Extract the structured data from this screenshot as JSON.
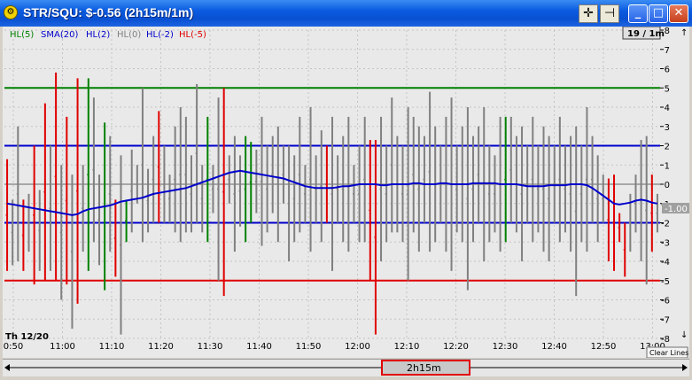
{
  "window": {
    "title": "STR/SQU: $-0.56 (2h15m/1m)",
    "icon": "gear-icon",
    "tool_buttons": [
      {
        "name": "crosshair-icon",
        "glyph": "✛"
      },
      {
        "name": "pin-icon",
        "glyph": "⊣"
      }
    ],
    "win_buttons": {
      "minimize": "_",
      "maximize": "□",
      "close": "✕"
    }
  },
  "legend": [
    {
      "label": "HL(5)",
      "color": "#008000"
    },
    {
      "label": "SMA(20)",
      "color": "#0000cc"
    },
    {
      "label": "HL(2)",
      "color": "#0000cc"
    },
    {
      "label": "HL(0)",
      "color": "#808080"
    },
    {
      "label": "HL(-2)",
      "color": "#0000cc"
    },
    {
      "label": "HL(-5)",
      "color": "#e00000"
    }
  ],
  "zoom_label": "19 / 1m",
  "current_value_label": "-1.00",
  "day_label": "Th 12/20",
  "clear_lines_label": "Clear Lines",
  "scroll_label": "2h15m",
  "colors": {
    "up": "#008000",
    "down": "#e00000",
    "neutral": "#808080",
    "sma": "#0000cc"
  },
  "chart_data": {
    "type": "bar",
    "x_tick_labels": [
      "0:50",
      "11:00",
      "11:10",
      "11:20",
      "11:30",
      "11:40",
      "11:50",
      "12:00",
      "12:10",
      "12:20",
      "12:30",
      "12:40",
      "12:50",
      "13:00"
    ],
    "y_ticks": [
      -8,
      -7,
      -6,
      -5,
      -4,
      -3,
      -2,
      -1,
      0,
      1,
      2,
      3,
      4,
      5,
      6,
      7,
      8
    ],
    "ylim": [
      -8,
      8
    ],
    "horizontal_lines": [
      {
        "name": "HL(5)",
        "value": 5,
        "color": "#008000"
      },
      {
        "name": "HL(2)",
        "value": 2,
        "color": "#0000cc"
      },
      {
        "name": "HL(0)",
        "value": 0,
        "color": "#808080"
      },
      {
        "name": "HL(-2)",
        "value": -2,
        "color": "#0000cc"
      },
      {
        "name": "HL(-5)",
        "value": -5,
        "color": "#e00000"
      }
    ],
    "ranges": [
      {
        "t": 0,
        "low": -4.5,
        "high": 1.3,
        "c": "down"
      },
      {
        "t": 1,
        "low": -4.2,
        "high": -0.8,
        "c": "neutral"
      },
      {
        "t": 2,
        "low": -4.0,
        "high": 3.0,
        "c": "neutral"
      },
      {
        "t": 3,
        "low": -4.5,
        "high": -0.8,
        "c": "down"
      },
      {
        "t": 4,
        "low": -3.5,
        "high": -0.5,
        "c": "neutral"
      },
      {
        "t": 5,
        "low": -5.2,
        "high": 2.0,
        "c": "down"
      },
      {
        "t": 6,
        "low": -4.5,
        "high": -0.3,
        "c": "neutral"
      },
      {
        "t": 7,
        "low": -5.0,
        "high": 4.2,
        "c": "down"
      },
      {
        "t": 8,
        "low": -4.5,
        "high": 2.0,
        "c": "neutral"
      },
      {
        "t": 9,
        "low": -5.0,
        "high": 5.8,
        "c": "down"
      },
      {
        "t": 10,
        "low": -6.0,
        "high": 1.0,
        "c": "neutral"
      },
      {
        "t": 11,
        "low": -5.2,
        "high": 3.5,
        "c": "down"
      },
      {
        "t": 12,
        "low": -7.5,
        "high": 0.5,
        "c": "neutral"
      },
      {
        "t": 13,
        "low": -6.2,
        "high": 5.5,
        "c": "down"
      },
      {
        "t": 14,
        "low": -3.5,
        "high": 1.0,
        "c": "neutral"
      },
      {
        "t": 15,
        "low": -4.5,
        "high": 5.5,
        "c": "up"
      },
      {
        "t": 16,
        "low": -3.0,
        "high": 4.5,
        "c": "neutral"
      },
      {
        "t": 17,
        "low": -4.2,
        "high": 0.5,
        "c": "neutral"
      },
      {
        "t": 18,
        "low": -5.5,
        "high": 3.2,
        "c": "up"
      },
      {
        "t": 19,
        "low": -3.5,
        "high": 2.5,
        "c": "neutral"
      },
      {
        "t": 20,
        "low": -4.8,
        "high": -0.8,
        "c": "down"
      },
      {
        "t": 21,
        "low": -7.8,
        "high": 1.5,
        "c": "neutral"
      },
      {
        "t": 22,
        "low": -3.0,
        "high": -0.8,
        "c": "up"
      },
      {
        "t": 23,
        "low": -2.5,
        "high": 1.8,
        "c": "neutral"
      },
      {
        "t": 24,
        "low": -1.0,
        "high": 1.0,
        "c": "neutral"
      },
      {
        "t": 25,
        "low": -3.0,
        "high": 5.0,
        "c": "neutral"
      },
      {
        "t": 26,
        "low": -2.5,
        "high": 0.8,
        "c": "neutral"
      },
      {
        "t": 27,
        "low": -2.0,
        "high": 2.5,
        "c": "neutral"
      },
      {
        "t": 28,
        "low": -2.0,
        "high": 3.8,
        "c": "down"
      },
      {
        "t": 29,
        "low": -2.0,
        "high": 2.0,
        "c": "neutral"
      },
      {
        "t": 30,
        "low": -2.0,
        "high": 0.5,
        "c": "neutral"
      },
      {
        "t": 31,
        "low": -2.5,
        "high": 3.0,
        "c": "neutral"
      },
      {
        "t": 32,
        "low": -3.0,
        "high": 4.0,
        "c": "neutral"
      },
      {
        "t": 33,
        "low": -2.5,
        "high": 3.5,
        "c": "neutral"
      },
      {
        "t": 34,
        "low": -2.5,
        "high": 1.5,
        "c": "neutral"
      },
      {
        "t": 35,
        "low": -2.0,
        "high": 5.2,
        "c": "neutral"
      },
      {
        "t": 36,
        "low": -2.5,
        "high": 1.0,
        "c": "neutral"
      },
      {
        "t": 37,
        "low": -3.0,
        "high": 3.5,
        "c": "up"
      },
      {
        "t": 38,
        "low": -1.5,
        "high": 1.0,
        "c": "neutral"
      },
      {
        "t": 39,
        "low": -5.0,
        "high": 4.5,
        "c": "neutral"
      },
      {
        "t": 40,
        "low": -5.8,
        "high": 5.0,
        "c": "down"
      },
      {
        "t": 41,
        "low": -1.0,
        "high": 1.5,
        "c": "neutral"
      },
      {
        "t": 42,
        "low": -3.5,
        "high": 2.5,
        "c": "neutral"
      },
      {
        "t": 43,
        "low": -2.2,
        "high": 1.5,
        "c": "neutral"
      },
      {
        "t": 44,
        "low": -3.0,
        "high": 2.5,
        "c": "up"
      },
      {
        "t": 45,
        "low": -2.0,
        "high": 2.2,
        "c": "up"
      },
      {
        "t": 46,
        "low": -1.5,
        "high": 1.8,
        "c": "neutral"
      },
      {
        "t": 47,
        "low": -3.2,
        "high": 3.5,
        "c": "neutral"
      },
      {
        "t": 48,
        "low": -2.5,
        "high": 2.0,
        "c": "neutral"
      },
      {
        "t": 49,
        "low": -1.5,
        "high": 2.5,
        "c": "neutral"
      },
      {
        "t": 50,
        "low": -3.0,
        "high": 3.0,
        "c": "neutral"
      },
      {
        "t": 51,
        "low": -1.0,
        "high": 2.0,
        "c": "neutral"
      },
      {
        "t": 52,
        "low": -4.0,
        "high": 2.0,
        "c": "neutral"
      },
      {
        "t": 53,
        "low": -3.0,
        "high": 1.5,
        "c": "neutral"
      },
      {
        "t": 54,
        "low": -2.5,
        "high": 3.5,
        "c": "neutral"
      },
      {
        "t": 55,
        "low": -2.0,
        "high": 1.0,
        "c": "neutral"
      },
      {
        "t": 56,
        "low": -3.5,
        "high": 4.0,
        "c": "neutral"
      },
      {
        "t": 57,
        "low": -2.0,
        "high": 1.5,
        "c": "neutral"
      },
      {
        "t": 58,
        "low": -3.0,
        "high": 2.8,
        "c": "neutral"
      },
      {
        "t": 59,
        "low": -2.0,
        "high": 2.0,
        "c": "down"
      },
      {
        "t": 60,
        "low": -4.5,
        "high": 3.5,
        "c": "neutral"
      },
      {
        "t": 61,
        "low": -2.0,
        "high": 1.5,
        "c": "neutral"
      },
      {
        "t": 62,
        "low": -3.0,
        "high": 2.5,
        "c": "neutral"
      },
      {
        "t": 63,
        "low": -3.5,
        "high": 3.5,
        "c": "neutral"
      },
      {
        "t": 64,
        "low": -2.0,
        "high": 1.0,
        "c": "neutral"
      },
      {
        "t": 65,
        "low": -3.0,
        "high": 2.0,
        "c": "neutral"
      },
      {
        "t": 66,
        "low": -3.0,
        "high": 3.5,
        "c": "neutral"
      },
      {
        "t": 67,
        "low": -5.0,
        "high": 2.3,
        "c": "down"
      },
      {
        "t": 68,
        "low": -7.8,
        "high": 2.3,
        "c": "down"
      },
      {
        "t": 69,
        "low": -4.0,
        "high": 3.5,
        "c": "neutral"
      },
      {
        "t": 70,
        "low": -3.0,
        "high": 2.0,
        "c": "neutral"
      },
      {
        "t": 71,
        "low": -2.5,
        "high": 4.5,
        "c": "neutral"
      },
      {
        "t": 72,
        "low": -2.5,
        "high": 2.5,
        "c": "neutral"
      },
      {
        "t": 73,
        "low": -3.0,
        "high": 2.0,
        "c": "neutral"
      },
      {
        "t": 74,
        "low": -5.0,
        "high": 4.0,
        "c": "neutral"
      },
      {
        "t": 75,
        "low": -2.5,
        "high": 3.5,
        "c": "neutral"
      },
      {
        "t": 76,
        "low": -3.5,
        "high": 3.0,
        "c": "neutral"
      },
      {
        "t": 77,
        "low": -2.0,
        "high": 2.5,
        "c": "neutral"
      },
      {
        "t": 78,
        "low": -3.5,
        "high": 4.8,
        "c": "neutral"
      },
      {
        "t": 79,
        "low": -3.0,
        "high": 3.0,
        "c": "neutral"
      },
      {
        "t": 80,
        "low": -2.0,
        "high": 2.0,
        "c": "neutral"
      },
      {
        "t": 81,
        "low": -3.5,
        "high": 3.5,
        "c": "neutral"
      },
      {
        "t": 82,
        "low": -4.5,
        "high": 4.5,
        "c": "neutral"
      },
      {
        "t": 83,
        "low": -2.5,
        "high": 2.0,
        "c": "neutral"
      },
      {
        "t": 84,
        "low": -3.0,
        "high": 3.0,
        "c": "neutral"
      },
      {
        "t": 85,
        "low": -5.5,
        "high": 4.0,
        "c": "neutral"
      },
      {
        "t": 86,
        "low": -3.0,
        "high": 2.5,
        "c": "neutral"
      },
      {
        "t": 87,
        "low": -2.0,
        "high": 3.0,
        "c": "neutral"
      },
      {
        "t": 88,
        "low": -4.0,
        "high": 4.0,
        "c": "neutral"
      },
      {
        "t": 89,
        "low": -3.0,
        "high": 2.0,
        "c": "neutral"
      },
      {
        "t": 90,
        "low": -2.5,
        "high": 1.5,
        "c": "neutral"
      },
      {
        "t": 91,
        "low": -3.5,
        "high": 3.5,
        "c": "neutral"
      },
      {
        "t": 92,
        "low": -3.0,
        "high": 3.5,
        "c": "up"
      },
      {
        "t": 93,
        "low": -2.0,
        "high": 3.5,
        "c": "neutral"
      },
      {
        "t": 94,
        "low": -2.5,
        "high": 2.5,
        "c": "neutral"
      },
      {
        "t": 95,
        "low": -4.0,
        "high": 3.0,
        "c": "neutral"
      },
      {
        "t": 96,
        "low": -2.0,
        "high": 2.0,
        "c": "neutral"
      },
      {
        "t": 97,
        "low": -3.0,
        "high": 3.5,
        "c": "neutral"
      },
      {
        "t": 98,
        "low": -2.5,
        "high": 2.0,
        "c": "neutral"
      },
      {
        "t": 99,
        "low": -3.5,
        "high": 3.0,
        "c": "neutral"
      },
      {
        "t": 100,
        "low": -4.0,
        "high": 2.5,
        "c": "neutral"
      },
      {
        "t": 101,
        "low": -2.0,
        "high": 2.0,
        "c": "neutral"
      },
      {
        "t": 102,
        "low": -3.0,
        "high": 3.5,
        "c": "neutral"
      },
      {
        "t": 103,
        "low": -2.5,
        "high": 2.0,
        "c": "neutral"
      },
      {
        "t": 104,
        "low": -3.5,
        "high": 2.5,
        "c": "neutral"
      },
      {
        "t": 105,
        "low": -5.8,
        "high": 3.0,
        "c": "neutral"
      },
      {
        "t": 106,
        "low": -3.0,
        "high": 2.0,
        "c": "neutral"
      },
      {
        "t": 107,
        "low": -3.5,
        "high": 4.0,
        "c": "neutral"
      },
      {
        "t": 108,
        "low": -2.0,
        "high": 2.5,
        "c": "neutral"
      },
      {
        "t": 109,
        "low": -3.0,
        "high": 1.5,
        "c": "neutral"
      },
      {
        "t": 110,
        "low": -2.0,
        "high": 0.5,
        "c": "neutral"
      },
      {
        "t": 111,
        "low": -4.0,
        "high": 0.3,
        "c": "down"
      },
      {
        "t": 112,
        "low": -4.5,
        "high": 0.5,
        "c": "down"
      },
      {
        "t": 113,
        "low": -3.0,
        "high": -1.5,
        "c": "down"
      },
      {
        "t": 114,
        "low": -4.8,
        "high": -2.0,
        "c": "down"
      },
      {
        "t": 115,
        "low": -3.5,
        "high": -0.5,
        "c": "neutral"
      },
      {
        "t": 116,
        "low": -2.5,
        "high": 0.5,
        "c": "neutral"
      },
      {
        "t": 117,
        "low": -4.0,
        "high": 2.3,
        "c": "neutral"
      },
      {
        "t": 118,
        "low": -5.2,
        "high": 2.5,
        "c": "neutral"
      },
      {
        "t": 119,
        "low": -3.5,
        "high": 0.5,
        "c": "down"
      },
      {
        "t": 120,
        "low": -2.5,
        "high": -0.5,
        "c": "neutral"
      }
    ],
    "sma": [
      -1.0,
      -1.05,
      -1.1,
      -1.15,
      -1.2,
      -1.25,
      -1.3,
      -1.35,
      -1.4,
      -1.45,
      -1.5,
      -1.55,
      -1.6,
      -1.55,
      -1.4,
      -1.3,
      -1.25,
      -1.2,
      -1.15,
      -1.1,
      -1.0,
      -0.9,
      -0.85,
      -0.8,
      -0.75,
      -0.7,
      -0.6,
      -0.5,
      -0.45,
      -0.4,
      -0.35,
      -0.3,
      -0.25,
      -0.2,
      -0.1,
      0.0,
      0.1,
      0.2,
      0.3,
      0.4,
      0.5,
      0.6,
      0.65,
      0.7,
      0.65,
      0.6,
      0.55,
      0.5,
      0.45,
      0.4,
      0.35,
      0.3,
      0.2,
      0.1,
      0.0,
      -0.1,
      -0.15,
      -0.2,
      -0.2,
      -0.2,
      -0.2,
      -0.15,
      -0.1,
      -0.1,
      -0.05,
      0.0,
      0.0,
      0.0,
      0.0,
      -0.05,
      -0.05,
      0.0,
      0.0,
      0.0,
      0.0,
      0.05,
      0.05,
      0.0,
      0.0,
      0.0,
      0.05,
      0.05,
      0.0,
      0.0,
      0.0,
      0.0,
      0.05,
      0.05,
      0.05,
      0.05,
      0.05,
      0.0,
      0.0,
      0.0,
      0.0,
      -0.05,
      -0.1,
      -0.1,
      -0.1,
      -0.1,
      -0.05,
      -0.05,
      -0.05,
      -0.05,
      0.0,
      0.0,
      0.0,
      -0.05,
      -0.2,
      -0.4,
      -0.6,
      -0.8,
      -1.0,
      -1.05,
      -1.0,
      -0.95,
      -0.85,
      -0.8,
      -0.85,
      -0.95,
      -1.0
    ]
  }
}
